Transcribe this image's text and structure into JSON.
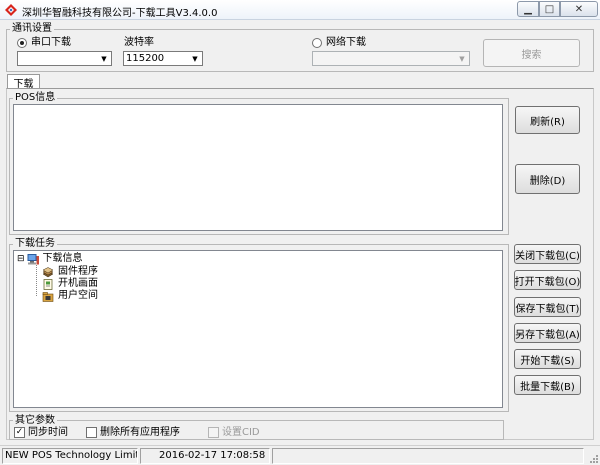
{
  "window": {
    "title": "深圳华智融科技有限公司-下载工具V3.4.0.0",
    "minimize_glyph": "▁",
    "maximize_glyph": "□",
    "close_glyph": "✕"
  },
  "comm": {
    "title": "通讯设置",
    "serial_label": "串口下载",
    "serial_selected": true,
    "port_value": "",
    "baud_label": "波特率",
    "baud_value": "115200",
    "network_label": "网络下载",
    "network_selected": false,
    "network_value": "",
    "search_label": "搜索"
  },
  "tabs": [
    {
      "label": "下载",
      "active": true
    }
  ],
  "pos_info": {
    "title": "POS信息",
    "content": "",
    "refresh_label": "刷新(R)",
    "delete_label": "删除(D)"
  },
  "tasks": {
    "title": "下载任务",
    "expander": "⊟",
    "root": "下载信息",
    "children": [
      "固件程序",
      "开机画面",
      "用户空间"
    ]
  },
  "task_buttons": {
    "close_pkg": "关闭下载包(C)",
    "open_pkg": "打开下载包(O)",
    "save_pkg": "保存下载包(T)",
    "save_as_pkg": "另存下载包(A)",
    "start": "开始下载(S)",
    "batch": "批量下载(B)"
  },
  "other_params": {
    "title": "其它参数",
    "sync_time_label": "同步时间",
    "sync_time_checked": true,
    "check_mark": "✓",
    "delete_apps_label": "删除所有应用程序",
    "delete_apps_checked": false,
    "set_cid_label": "设置CID",
    "set_cid_checked": false
  },
  "status": {
    "company": "NEW POS Technology Limite",
    "datetime": "2016-02-17 17:08:58"
  },
  "colors": {
    "window_bg": "#f0f0f0",
    "app_icon_red": "#d8241c",
    "app_icon_blue": "#2b63b8"
  }
}
